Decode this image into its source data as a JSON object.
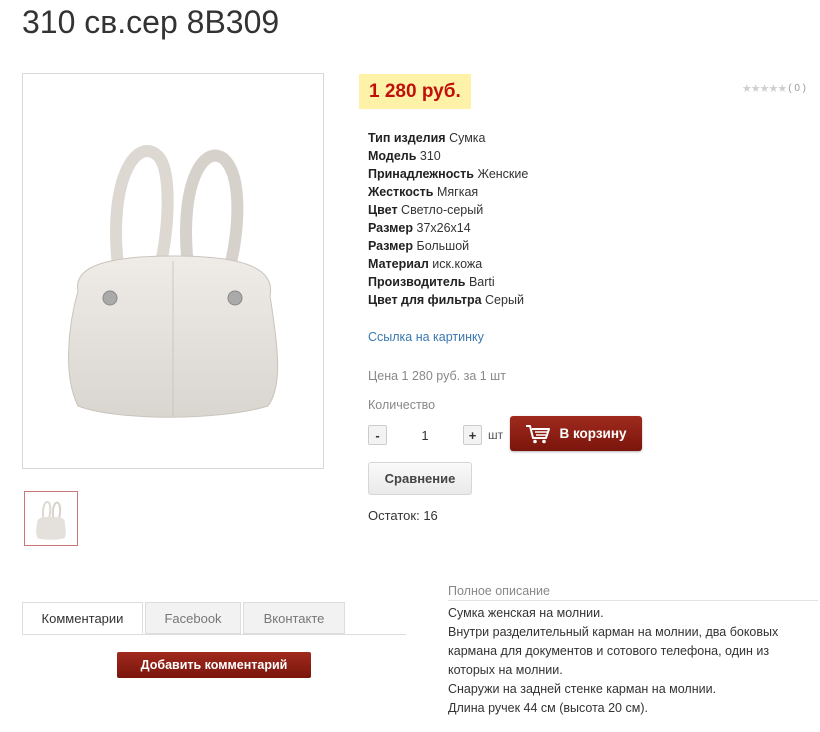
{
  "product": {
    "title": "310 св.сер 8В309",
    "price_badge": "1 280 руб.",
    "rating_text": "( 0 )",
    "rating_stars": "★★★★★",
    "specs": [
      {
        "key": "Тип изделия",
        "value": "Сумка"
      },
      {
        "key": "Модель",
        "value": "310"
      },
      {
        "key": "Принадлежность",
        "value": "Женские"
      },
      {
        "key": "Жесткость",
        "value": "Мягкая"
      },
      {
        "key": "Цвет",
        "value": "Светло-серый"
      },
      {
        "key": "Размер",
        "value": "37х26х14"
      },
      {
        "key": "Размер",
        "value": "Большой"
      },
      {
        "key": "Материал",
        "value": "иск.кожа"
      },
      {
        "key": "Производитель",
        "value": "Barti"
      },
      {
        "key": "Цвет для фильтра",
        "value": "Серый"
      }
    ],
    "image_link": "Ссылка на картинку",
    "price_line": "Цена 1 280 руб. за 1 шт",
    "qty_label": "Количество",
    "qty_value": "1",
    "minus": "-",
    "plus": "+",
    "unit": "шт",
    "cart_button": "В корзину",
    "compare_button": "Сравнение",
    "stock": "Остаток: 16"
  },
  "tabs": [
    "Комментарии",
    "Facebook",
    "Вконтакте"
  ],
  "add_comment": "Добавить комментарий",
  "description": {
    "heading": "Полное описание",
    "lines": [
      "Сумка женская на молнии.",
      "Внутри разделительный карман на молнии, два боковых",
      "кармана для документов и сотового телефона, один из",
      "которых на молнии.",
      "Снаружи на задней стенке карман на молнии.",
      "Длина ручек 44 см (высота 20 см)."
    ]
  },
  "colors": {
    "price": "#c0100c",
    "price_bg": "#fdf2a8",
    "button_red": "#8e2015",
    "link": "#3a78b0"
  }
}
